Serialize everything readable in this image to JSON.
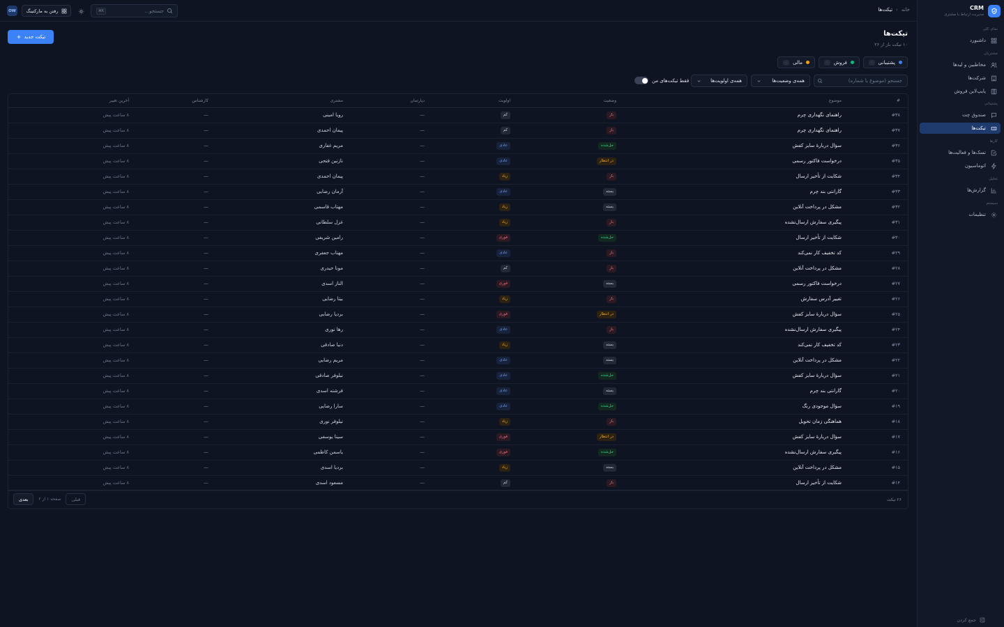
{
  "brand": {
    "title": "CRM",
    "subtitle": "مدیریت ارتباط با مشتری"
  },
  "sidebar": {
    "sections": [
      {
        "label": "نمای کلی",
        "items": [
          {
            "label": "داشبورد",
            "icon": "dashboard-icon",
            "active": false
          }
        ]
      },
      {
        "label": "مشتریان",
        "items": [
          {
            "label": "مخاطبین و لیدها",
            "icon": "users-icon",
            "active": false
          },
          {
            "label": "شرکت‌ها",
            "icon": "building-icon",
            "active": false
          },
          {
            "label": "پایپ‌لاین فروش",
            "icon": "pipeline-icon",
            "active": false
          }
        ]
      },
      {
        "label": "پشتیبانی",
        "items": [
          {
            "label": "صندوق چت",
            "icon": "chat-icon",
            "active": false
          },
          {
            "label": "تیکت‌ها",
            "icon": "ticket-icon",
            "active": true
          }
        ]
      },
      {
        "label": "کارها",
        "items": [
          {
            "label": "تسک‌ها و فعالیت‌ها",
            "icon": "check-square-icon",
            "active": false
          },
          {
            "label": "اتوماسیون",
            "icon": "zap-icon",
            "active": false
          }
        ]
      },
      {
        "label": "تحلیل",
        "items": [
          {
            "label": "گزارش‌ها",
            "icon": "chart-icon",
            "active": false
          }
        ]
      },
      {
        "label": "سیستم",
        "items": [
          {
            "label": "تنظیمات",
            "icon": "gear-icon",
            "active": false
          }
        ]
      }
    ],
    "collapse_label": "جمع کردن"
  },
  "topbar": {
    "breadcrumb": [
      "خانه",
      "تیکت‌ها"
    ],
    "search_placeholder": "جستجو...",
    "kbd": "K⌘",
    "marketing_label": "رفتن به مارکتینگ",
    "avatar_initials": "OW"
  },
  "header": {
    "title": "تیکت‌ها",
    "subtitle": "۱۰ تیکت باز از ۲۶",
    "new_button": "تیکت جدید"
  },
  "queues": [
    {
      "label": "پشتیبانی",
      "count": "۰",
      "color": "#3b82f6"
    },
    {
      "label": "فروش",
      "count": "۰",
      "color": "#10b981"
    },
    {
      "label": "مالی",
      "count": "۰",
      "color": "#f59e0b"
    }
  ],
  "filters": {
    "search_placeholder": "جستجو (موضوع یا شماره)",
    "status_select": "همه‌ی وضعیت‌ها",
    "priority_select": "همه‌ی اولویت‌ها",
    "mine_label": "فقط تیکت‌های من",
    "mine_on": true
  },
  "table": {
    "columns": {
      "id": "#",
      "subject": "موضوع",
      "status": "وضعیت",
      "priority": "اولویت",
      "department": "دپارتمان",
      "customer": "مشتری",
      "agent": "کارشناس",
      "updated": "آخرین تغییر"
    },
    "rows": [
      {
        "id": "#۳۸",
        "subject": "راهنمای نگهداری چرم",
        "status": "باز",
        "status_key": "open",
        "priority": "کم",
        "priority_key": "low",
        "department": "—",
        "customer": "رویا امینی",
        "agent": "—",
        "updated": "۸ ساعت پیش"
      },
      {
        "id": "#۳۷",
        "subject": "راهنمای نگهداری چرم",
        "status": "باز",
        "status_key": "open",
        "priority": "کم",
        "priority_key": "low",
        "department": "—",
        "customer": "پیمان احمدی",
        "agent": "—",
        "updated": "۸ ساعت پیش"
      },
      {
        "id": "#۳۶",
        "subject": "سؤال دربارهٔ سایز کفش",
        "status": "حل‌شده",
        "status_key": "resolved",
        "priority": "عادی",
        "priority_key": "normal",
        "department": "—",
        "customer": "مریم غفاری",
        "agent": "—",
        "updated": "۸ ساعت پیش"
      },
      {
        "id": "#۳۵",
        "subject": "درخواست فاکتور رسمی",
        "status": "در انتظار",
        "status_key": "pending",
        "priority": "عادی",
        "priority_key": "normal",
        "department": "—",
        "customer": "نازنین فتحی",
        "agent": "—",
        "updated": "۸ ساعت پیش"
      },
      {
        "id": "#۳۴",
        "subject": "شکایت از تأخیر ارسال",
        "status": "باز",
        "status_key": "open",
        "priority": "زیاد",
        "priority_key": "high",
        "department": "—",
        "customer": "پیمان احمدی",
        "agent": "—",
        "updated": "۸ ساعت پیش"
      },
      {
        "id": "#۳۳",
        "subject": "گارانتی بند چرم",
        "status": "بسته",
        "status_key": "closed",
        "priority": "عادی",
        "priority_key": "normal",
        "department": "—",
        "customer": "آرمان رضایی",
        "agent": "—",
        "updated": "۸ ساعت پیش"
      },
      {
        "id": "#۳۲",
        "subject": "مشکل در پرداخت آنلاین",
        "status": "بسته",
        "status_key": "closed",
        "priority": "زیاد",
        "priority_key": "high",
        "department": "—",
        "customer": "مهتاب قاسمی",
        "agent": "—",
        "updated": "۸ ساعت پیش"
      },
      {
        "id": "#۳۱",
        "subject": "پیگیری سفارش ارسال‌نشده",
        "status": "باز",
        "status_key": "open",
        "priority": "زیاد",
        "priority_key": "high",
        "department": "—",
        "customer": "غزل سلطانی",
        "agent": "—",
        "updated": "۸ ساعت پیش"
      },
      {
        "id": "#۳۰",
        "subject": "شکایت از تأخیر ارسال",
        "status": "حل‌شده",
        "status_key": "resolved",
        "priority": "فوری",
        "priority_key": "urgent",
        "department": "—",
        "customer": "رامین شریفی",
        "agent": "—",
        "updated": "۸ ساعت پیش"
      },
      {
        "id": "#۲۹",
        "subject": "کد تخفیف کار نمی‌کند",
        "status": "باز",
        "status_key": "open",
        "priority": "عادی",
        "priority_key": "normal",
        "department": "—",
        "customer": "مهتاب جعفری",
        "agent": "—",
        "updated": "۸ ساعت پیش"
      },
      {
        "id": "#۲۸",
        "subject": "مشکل در پرداخت آنلاین",
        "status": "باز",
        "status_key": "open",
        "priority": "کم",
        "priority_key": "low",
        "department": "—",
        "customer": "مونا حیدری",
        "agent": "—",
        "updated": "۸ ساعت پیش"
      },
      {
        "id": "#۲۷",
        "subject": "درخواست فاکتور رسمی",
        "status": "بسته",
        "status_key": "closed",
        "priority": "فوری",
        "priority_key": "urgent",
        "department": "—",
        "customer": "الناز اسدی",
        "agent": "—",
        "updated": "۸ ساعت پیش"
      },
      {
        "id": "#۲۶",
        "subject": "تغییر آدرس سفارش",
        "status": "باز",
        "status_key": "open",
        "priority": "زیاد",
        "priority_key": "high",
        "department": "—",
        "customer": "بیتا رضایی",
        "agent": "—",
        "updated": "۸ ساعت پیش"
      },
      {
        "id": "#۲۵",
        "subject": "سؤال دربارهٔ سایز کفش",
        "status": "در انتظار",
        "status_key": "pending",
        "priority": "فوری",
        "priority_key": "urgent",
        "department": "—",
        "customer": "بردیا رضایی",
        "agent": "—",
        "updated": "۸ ساعت پیش"
      },
      {
        "id": "#۲۴",
        "subject": "پیگیری سفارش ارسال‌نشده",
        "status": "باز",
        "status_key": "open",
        "priority": "عادی",
        "priority_key": "normal",
        "department": "—",
        "customer": "رها نوری",
        "agent": "—",
        "updated": "۸ ساعت پیش"
      },
      {
        "id": "#۲۳",
        "subject": "کد تخفیف کار نمی‌کند",
        "status": "بسته",
        "status_key": "closed",
        "priority": "زیاد",
        "priority_key": "high",
        "department": "—",
        "customer": "دنیا صادقی",
        "agent": "—",
        "updated": "۸ ساعت پیش"
      },
      {
        "id": "#۲۲",
        "subject": "مشکل در پرداخت آنلاین",
        "status": "بسته",
        "status_key": "closed",
        "priority": "عادی",
        "priority_key": "normal",
        "department": "—",
        "customer": "مریم رضایی",
        "agent": "—",
        "updated": "۸ ساعت پیش"
      },
      {
        "id": "#۲۱",
        "subject": "سؤال دربارهٔ سایز کفش",
        "status": "حل‌شده",
        "status_key": "resolved",
        "priority": "عادی",
        "priority_key": "normal",
        "department": "—",
        "customer": "نیلوفر صادقی",
        "agent": "—",
        "updated": "۸ ساعت پیش"
      },
      {
        "id": "#۲۰",
        "subject": "گارانتی بند چرم",
        "status": "بسته",
        "status_key": "closed",
        "priority": "عادی",
        "priority_key": "normal",
        "department": "—",
        "customer": "فرشته اسدی",
        "agent": "—",
        "updated": "۸ ساعت پیش"
      },
      {
        "id": "#۱۹",
        "subject": "سؤال موجودی رنگ",
        "status": "حل‌شده",
        "status_key": "resolved",
        "priority": "عادی",
        "priority_key": "normal",
        "department": "—",
        "customer": "سارا رضایی",
        "agent": "—",
        "updated": "۸ ساعت پیش"
      },
      {
        "id": "#۱۸",
        "subject": "هماهنگی زمان تحویل",
        "status": "باز",
        "status_key": "open",
        "priority": "زیاد",
        "priority_key": "high",
        "department": "—",
        "customer": "نیلوفر نوری",
        "agent": "—",
        "updated": "۸ ساعت پیش"
      },
      {
        "id": "#۱۷",
        "subject": "سؤال دربارهٔ سایز کفش",
        "status": "در انتظار",
        "status_key": "pending",
        "priority": "فوری",
        "priority_key": "urgent",
        "department": "—",
        "customer": "سینا یوسفی",
        "agent": "—",
        "updated": "۸ ساعت پیش"
      },
      {
        "id": "#۱۶",
        "subject": "پیگیری سفارش ارسال‌نشده",
        "status": "حل‌شده",
        "status_key": "resolved",
        "priority": "فوری",
        "priority_key": "urgent",
        "department": "—",
        "customer": "یاسمن کاظمی",
        "agent": "—",
        "updated": "۸ ساعت پیش"
      },
      {
        "id": "#۱۵",
        "subject": "مشکل در پرداخت آنلاین",
        "status": "بسته",
        "status_key": "closed",
        "priority": "زیاد",
        "priority_key": "high",
        "department": "—",
        "customer": "بردیا اسدی",
        "agent": "—",
        "updated": "۸ ساعت پیش"
      },
      {
        "id": "#۱۴",
        "subject": "شکایت از تأخیر ارسال",
        "status": "باز",
        "status_key": "open",
        "priority": "کم",
        "priority_key": "low",
        "department": "—",
        "customer": "مسعود اسدی",
        "agent": "—",
        "updated": "۸ ساعت پیش"
      }
    ]
  },
  "footer": {
    "total": "۲۶ تیکت",
    "page_info": "صفحه ۱ از ۲",
    "prev_label": "قبلی",
    "next_label": "بعدی"
  }
}
